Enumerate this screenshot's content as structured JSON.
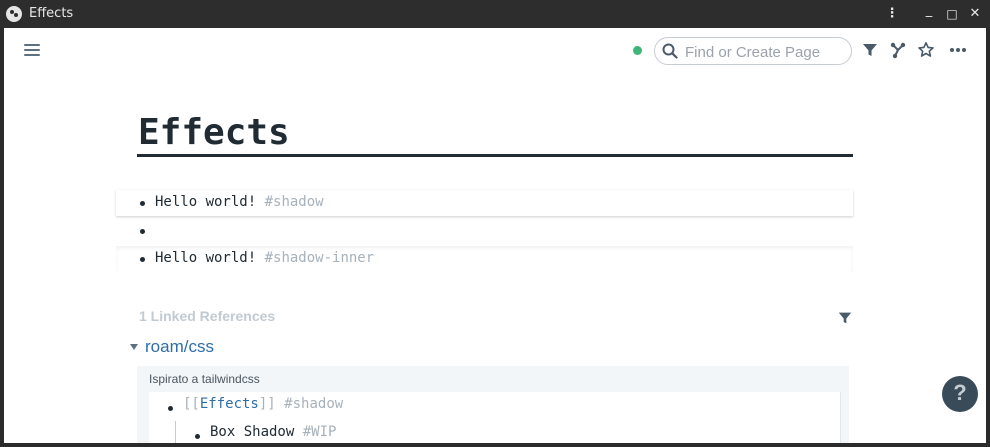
{
  "window": {
    "title": "Effects",
    "controls": {
      "menu": "⋮",
      "minimize": "_",
      "maximize": "□",
      "close": "✕"
    }
  },
  "topbar": {
    "sync_color": "#3fb57a",
    "search_placeholder": "Find or Create Page",
    "icons": [
      "menu-icon",
      "search-icon",
      "filter-icon",
      "graph-icon",
      "star-icon",
      "more-icon"
    ]
  },
  "page": {
    "title": "Effects",
    "blocks": [
      {
        "text": "Hello world!",
        "tag": "#shadow"
      },
      {
        "text": "",
        "tag": ""
      },
      {
        "text": "Hello world!",
        "tag": "#shadow-inner"
      }
    ]
  },
  "linked_refs": {
    "title": "1 Linked References",
    "page": "roam/css",
    "breadcrumb": "Ispirato a tailwindcss",
    "items": [
      {
        "open": "[[",
        "link": "Effects",
        "close": "]]",
        "tag": "#shadow"
      },
      {
        "text": "Box Shadow",
        "tag": "#WIP"
      }
    ]
  },
  "help": {
    "label": "?"
  },
  "colors": {
    "accent": "#2e6ea8",
    "text": "#202b33",
    "muted": "#a7b1ba",
    "help_bg": "#394b59"
  }
}
